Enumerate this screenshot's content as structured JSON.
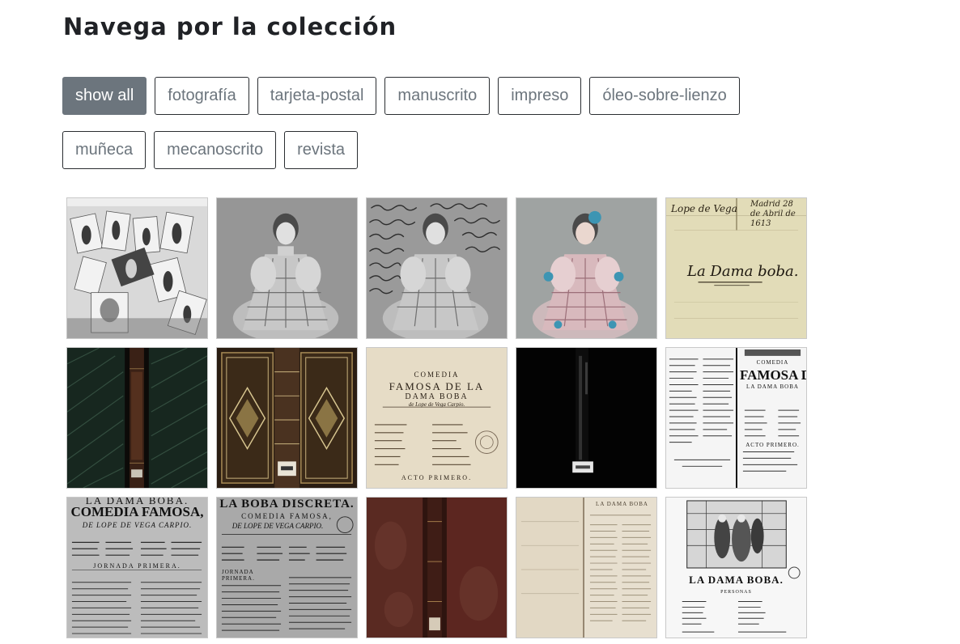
{
  "page_title": "Navega por la colección",
  "filters": [
    {
      "label": "show all",
      "active": true
    },
    {
      "label": "fotografía",
      "active": false
    },
    {
      "label": "tarjeta-postal",
      "active": false
    },
    {
      "label": "manuscrito",
      "active": false
    },
    {
      "label": "impreso",
      "active": false
    },
    {
      "label": "óleo-sobre-lienzo",
      "active": false
    },
    {
      "label": "muñeca",
      "active": false
    },
    {
      "label": "mecanoscrito",
      "active": false
    },
    {
      "label": "revista",
      "active": false
    }
  ],
  "gallery": {
    "manuscript_thumb": {
      "author": "Lope de Vega",
      "date": "Madrid 28 de Abril de 1613",
      "title": "La Dama boba."
    },
    "comedia_thumb": {
      "heading": "COMEDIA",
      "title_line1": "FAMOSA DE LA",
      "title_line2": "DAMA BOBA",
      "byline": "de Lope de Vega Carpio.",
      "footer": "ACTO PRIMERO."
    },
    "spread_thumb": {
      "heading": "COMEDIA",
      "title": "FAMOSA D",
      "subtitle": "LA DAMA BOBA",
      "footer": "ACTO PRIMERO."
    },
    "dama_boba_thumb": {
      "line1": "LA DAMA BOBA.",
      "line2": "COMEDIA FAMOSA,",
      "line3": "DE LOPE DE VEGA CARPIO.",
      "line4": "JORNADA PRIMERA."
    },
    "boba_discreta_thumb": {
      "line1": "LA BOBA DISCRETA.",
      "line2": "COMEDIA FAMOSA,",
      "line3": "DE LOPE DE VEGA CARPIO.",
      "line4": "JORNADA PRIMERA."
    },
    "magazine_open_thumb": {
      "heading": "LA DAMA BOBA"
    },
    "magazine_cover_thumb": {
      "title": "LA DAMA BOBA.",
      "subtitle": "PERSONAS"
    }
  }
}
